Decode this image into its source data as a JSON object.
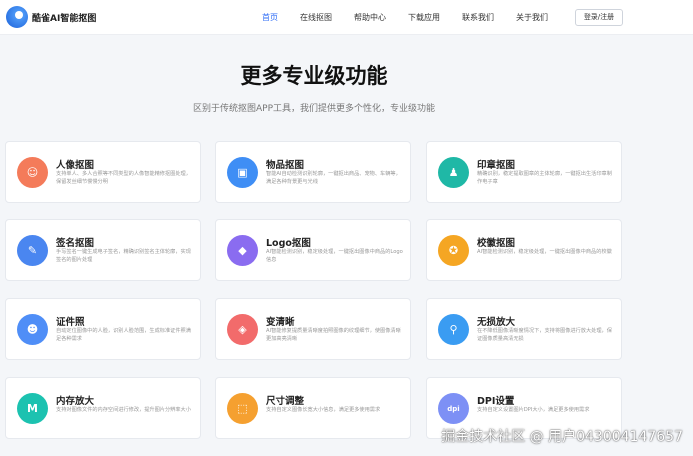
{
  "brand": {
    "name": "酷雀AI智能抠图",
    "logo_icon": "bird-logo-icon"
  },
  "nav": {
    "items": [
      {
        "label": "首页",
        "active": true
      },
      {
        "label": "在线抠图",
        "active": false
      },
      {
        "label": "帮助中心",
        "active": false
      },
      {
        "label": "下载应用",
        "active": false
      },
      {
        "label": "联系我们",
        "active": false
      },
      {
        "label": "关于我们",
        "active": false
      }
    ],
    "login_label": "登录/注册"
  },
  "hero": {
    "title": "更多专业级功能",
    "subtitle": "区别于传统抠图APP工具，我们提供更多个性化，专业级功能"
  },
  "features": [
    {
      "title": "人像抠图",
      "desc": "支持单人、多人合照等不同类型的人像智能精修抠图处理，保留发丝细节慢慢分明",
      "icon": "portrait-icon",
      "color": "#f47b5a"
    },
    {
      "title": "物品抠图",
      "desc": "智能AI自动检测识别轮廓，一键抠出商品、宠物、车辆等，满足各种背景更与光线",
      "icon": "box-icon",
      "color": "#3f8ef5"
    },
    {
      "title": "印章抠图",
      "desc": "精确识别，稳定提取图章的主体轮廓，一键抠出生活印章制作电子章",
      "icon": "stamp-icon",
      "color": "#1fb8a6"
    },
    {
      "title": "签名抠图",
      "desc": "手写签名一键生成电子签名，精确识别签名主体轮廓，实现签名的图片处理",
      "icon": "pen-icon",
      "color": "#4a86f0"
    },
    {
      "title": "Logo抠图",
      "desc": "AI智能检测识别，稳定级处理，一键抠出图像中商品的Logo信息",
      "icon": "logo-icon",
      "color": "#8a6cf0"
    },
    {
      "title": "校徽抠图",
      "desc": "AI智能检测识别，稳定级处理，一键抠出图像中商品的校徽",
      "icon": "badge-icon",
      "color": "#f5a623"
    },
    {
      "title": "证件照",
      "desc": "自动定位图像中的人脸，识别人脸范围，生成标准证件照满足各种需求",
      "icon": "id-photo-icon",
      "color": "#4f8ef7"
    },
    {
      "title": "变清晰",
      "desc": "AI智能修复提质量清晰度拍照图像的纹理细节，使图像清晰更加高亮清晰",
      "icon": "sharpen-icon",
      "color": "#f26b6b"
    },
    {
      "title": "无损放大",
      "desc": "在不降低图像清晰度情况下，支持将图像进行放大处理，保证图像质量高清无损",
      "icon": "magnifier-icon",
      "color": "#3a9cf2"
    },
    {
      "title": "内存放大",
      "desc": "支持对图像文件的内存空间进行修改，提升图片分辨率大小",
      "icon": "memory-icon",
      "color": "#1cc2b0"
    },
    {
      "title": "尺寸调整",
      "desc": "支持自定义图像长宽大小信息，满足更多使用需求",
      "icon": "crop-icon",
      "color": "#f5a030"
    },
    {
      "title": "DPI设置",
      "desc": "支持自定义设置图片DPI大小，满足更多使用需求",
      "icon": "dpi-icon",
      "color": "#7d90f5"
    }
  ],
  "watermark": "掘金技术社区 @ 用户043004147657"
}
